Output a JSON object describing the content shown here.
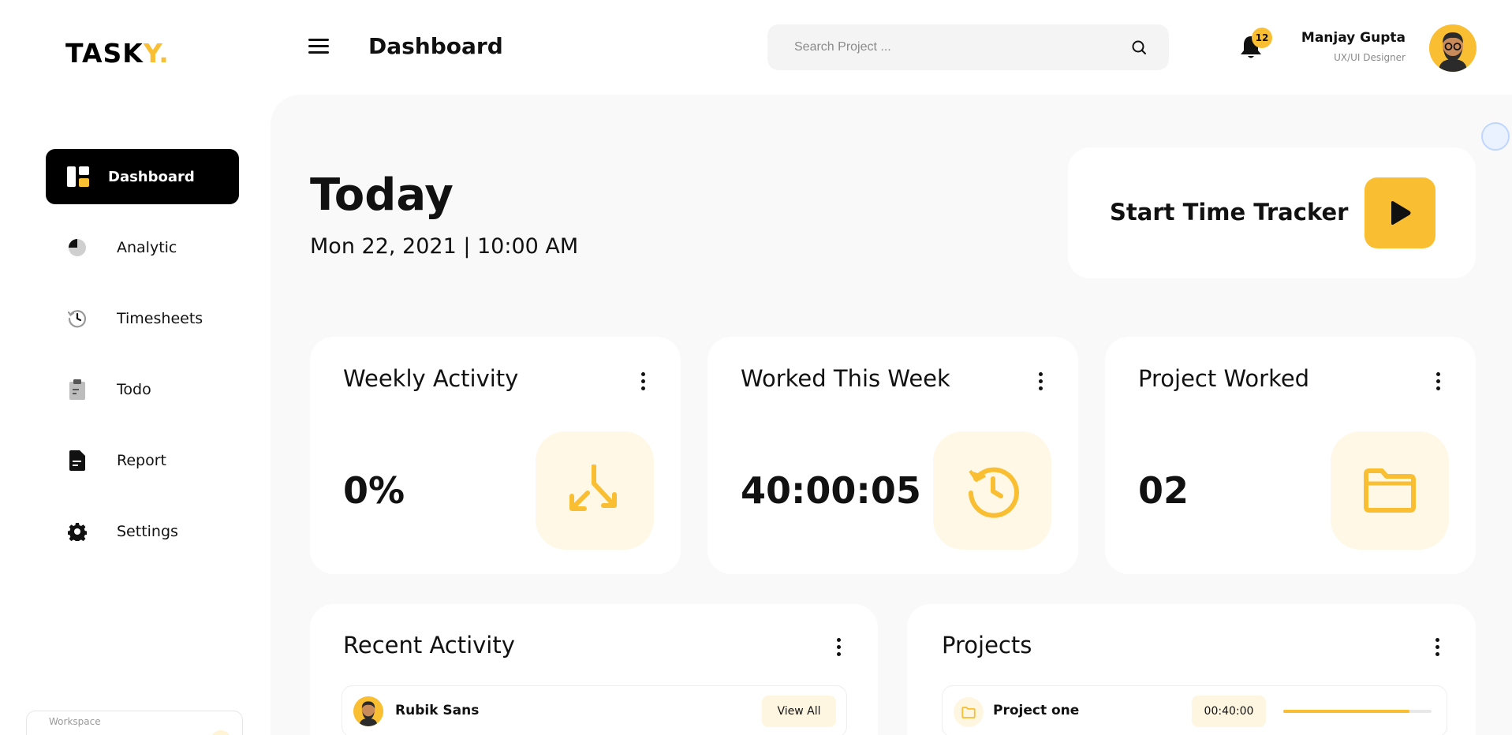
{
  "brand": {
    "logo_main": "TASK",
    "logo_accent": "Y",
    "logo_dot": ".",
    "accent_color": "#F9BE32"
  },
  "sidebar": {
    "items": [
      {
        "label": "Dashboard",
        "icon": "dashboard-icon",
        "active": true
      },
      {
        "label": "Analytic",
        "icon": "pie-chart-icon"
      },
      {
        "label": "Timesheets",
        "icon": "history-clock-icon"
      },
      {
        "label": "Todo",
        "icon": "clipboard-icon"
      },
      {
        "label": "Report",
        "icon": "document-icon"
      },
      {
        "label": "Settings",
        "icon": "gear-icon"
      }
    ],
    "workspace_label": "Workspace"
  },
  "header": {
    "title": "Dashboard",
    "search_placeholder": "Search Project ...",
    "notifications_count": "12",
    "user_name": "Manjay Gupta",
    "user_role": "UX/UI Designer"
  },
  "today": {
    "title": "Today",
    "date": "Mon 22, 2021 | 10:00 AM"
  },
  "tracker": {
    "label": "Start Time Tracker"
  },
  "cards": [
    {
      "title": "Weekly Activity",
      "value": "0%",
      "icon": "merge-arrows-icon"
    },
    {
      "title": "Worked This Week",
      "value": "40:00:05",
      "icon": "history-clock-icon"
    },
    {
      "title": "Project Worked",
      "value": "02",
      "icon": "folder-icon"
    }
  ],
  "recent_activity": {
    "title": "Recent Activity",
    "rows": [
      {
        "name": "Rubik Sans",
        "action": "View All"
      }
    ]
  },
  "projects": {
    "title": "Projects",
    "rows": [
      {
        "name": "Project one",
        "time": "00:40:00",
        "progress": 0.85
      }
    ]
  }
}
